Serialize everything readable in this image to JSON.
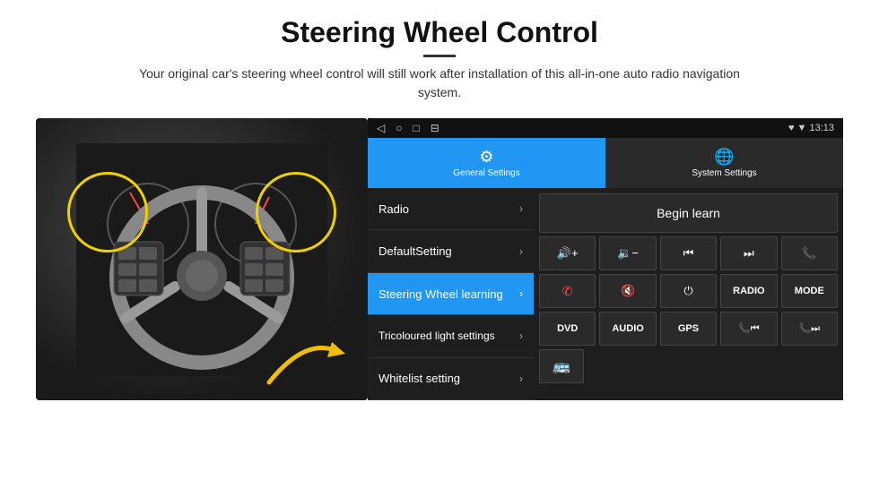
{
  "page": {
    "title": "Steering Wheel Control",
    "divider": true,
    "subtitle": "Your original car's steering wheel control will still work after installation of this all-in-one auto radio navigation system."
  },
  "status_bar": {
    "icons": [
      "◁",
      "○",
      "□",
      "⊟"
    ],
    "right_info": "♥ ▼ 13:13"
  },
  "tabs": [
    {
      "id": "general",
      "label": "General Settings",
      "active": true
    },
    {
      "id": "system",
      "label": "System Settings",
      "active": false
    }
  ],
  "menu_items": [
    {
      "id": "radio",
      "label": "Radio",
      "active": false
    },
    {
      "id": "default",
      "label": "DefaultSetting",
      "active": false
    },
    {
      "id": "steering",
      "label": "Steering Wheel learning",
      "active": true
    },
    {
      "id": "tricolour",
      "label": "Tricoloured light settings",
      "active": false
    },
    {
      "id": "whitelist",
      "label": "Whitelist setting",
      "active": false
    }
  ],
  "begin_learn_label": "Begin learn",
  "control_buttons_row1": [
    {
      "id": "vol_up",
      "label": "🔊+"
    },
    {
      "id": "vol_down",
      "label": "🔉-"
    },
    {
      "id": "prev",
      "label": "⏮"
    },
    {
      "id": "next",
      "label": "⏭"
    },
    {
      "id": "phone",
      "label": "✆"
    }
  ],
  "control_buttons_row2": [
    {
      "id": "call_end",
      "label": "✆"
    },
    {
      "id": "mute",
      "label": "🔇"
    },
    {
      "id": "power",
      "label": "⏻"
    },
    {
      "id": "radio_btn",
      "label": "RADIO",
      "text": true
    },
    {
      "id": "mode_btn",
      "label": "MODE",
      "text": true
    }
  ],
  "control_buttons_row3": [
    {
      "id": "dvd",
      "label": "DVD",
      "text": true
    },
    {
      "id": "audio",
      "label": "AUDIO",
      "text": true
    },
    {
      "id": "gps",
      "label": "GPS",
      "text": true
    },
    {
      "id": "tel_prev",
      "label": "✆⏮"
    },
    {
      "id": "tel_next",
      "label": "✆⏭"
    }
  ],
  "whitelist_icon": "🚌",
  "icons": {
    "gear": "⚙",
    "globe": "🌐",
    "chevron_right": "›",
    "back_arrow": "◁",
    "home": "○",
    "recent": "□",
    "screenshot": "⊟"
  }
}
